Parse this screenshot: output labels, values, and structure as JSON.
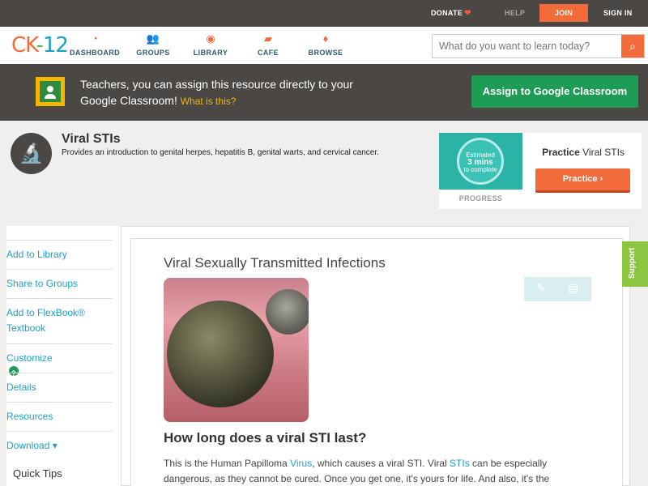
{
  "topbar": {
    "donate": "DONATE",
    "help": "HELP",
    "join": "JOIN",
    "signin": "SIGN IN"
  },
  "header": {
    "logo": {
      "ck": "CK",
      "dash": "-",
      "num": "12"
    },
    "nav": [
      {
        "label": "DASHBOARD",
        "icon": "dashboard-icon"
      },
      {
        "label": "GROUPS",
        "icon": "groups-icon"
      },
      {
        "label": "LIBRARY",
        "icon": "library-icon"
      },
      {
        "label": "CAFE",
        "icon": "cafe-icon"
      },
      {
        "label": "BROWSE",
        "icon": "browse-icon"
      }
    ],
    "search_placeholder": "What do you want to learn today?"
  },
  "banner": {
    "text": "Teachers, you can assign this resource directly to your Google Classroom!",
    "what_link": "What is this?",
    "assign_button": "Assign to Google Classroom"
  },
  "concept": {
    "title": "Viral STIs",
    "description": "Provides an introduction to genital herpes, hepatitis B, genital warts, and cervical cancer."
  },
  "practice": {
    "ring_line1": "Estimated",
    "ring_line2": "3 mins",
    "ring_line3": "to complete",
    "progress_label": "PROGRESS",
    "title_bold": "Practice",
    "title_rest": "Viral STIs",
    "button": "Practice"
  },
  "sidebar": {
    "items": [
      {
        "label": "Add to Library"
      },
      {
        "label": "Share to Groups"
      },
      {
        "label": "Add to FlexBook® Textbook"
      },
      {
        "label": "Customize"
      },
      {
        "label": "Details"
      },
      {
        "label": "Resources"
      },
      {
        "label": "Download ▾"
      }
    ],
    "quick_tips": "Quick Tips"
  },
  "article": {
    "title": "Viral Sexually Transmitted Infections",
    "heading": "How long does a viral STI last?",
    "para_1": "This is the Human Papilloma ",
    "link_virus": "Virus",
    "para_2": ", which causes a viral STI. Viral ",
    "link_stis": "STIs",
    "para_3": " can be especially dangerous, as they cannot be cured. Once you get one, it's yours for life. And also, it's the"
  },
  "support": "Support"
}
